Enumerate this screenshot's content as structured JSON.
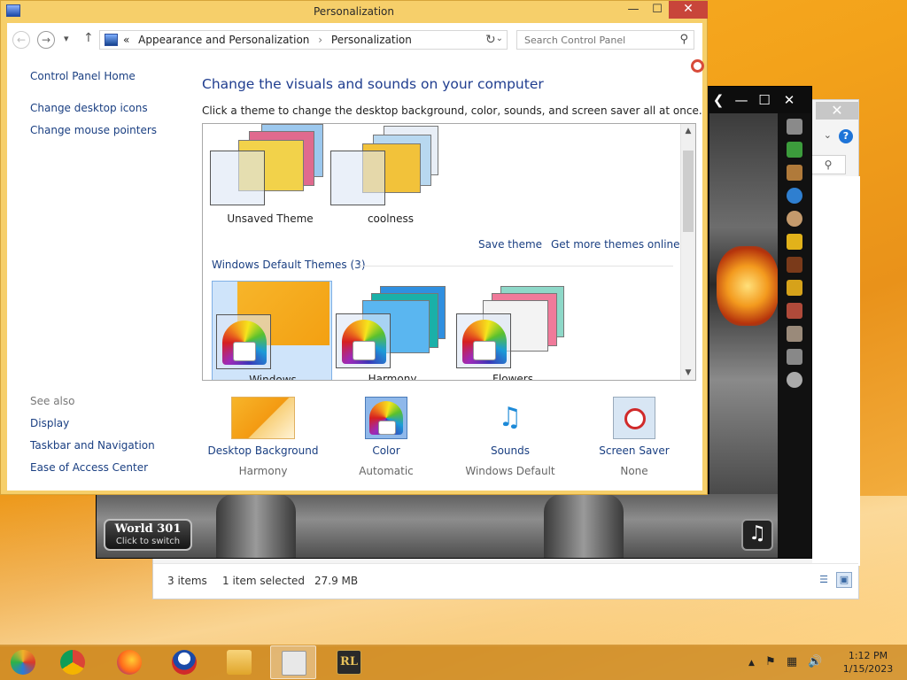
{
  "window": {
    "title": "Personalization",
    "minimize": "—",
    "maximize": "☐",
    "close": "✕"
  },
  "nav": {
    "back": "←",
    "forward": "→",
    "recent": "▾",
    "up": "↑",
    "breadcrumb": [
      "Appearance and Personalization",
      "Personalization"
    ],
    "breadcrumb_prefix": "«",
    "separator": "›",
    "dropdown": "⌄",
    "refresh": "↻",
    "search_placeholder": "Search Control Panel",
    "search_icon": "⚲"
  },
  "left_nav": {
    "home": "Control Panel Home",
    "items": [
      "Change desktop icons",
      "Change mouse pointers"
    ]
  },
  "see_also": {
    "title": "See also",
    "items": [
      "Display",
      "Taskbar and Navigation",
      "Ease of Access Center"
    ]
  },
  "main": {
    "title": "Change the visuals and sounds on your computer",
    "subtitle": "Click a theme to change the desktop background, color, sounds, and screen saver all at once.",
    "my_themes": [
      {
        "name": "Unsaved Theme"
      },
      {
        "name": "coolness"
      }
    ],
    "links": {
      "save": "Save theme",
      "more": "Get more themes online"
    },
    "default_group": "Windows Default Themes (3)",
    "default_themes": [
      {
        "name": "Windows",
        "selected": true
      },
      {
        "name": "Harmony",
        "selected": false
      },
      {
        "name": "Flowers",
        "selected": false
      }
    ],
    "scroll_up": "▲",
    "scroll_down": "▼"
  },
  "bottom": [
    {
      "link": "Desktop Background",
      "value": "Harmony",
      "icon": "desktop-background-icon"
    },
    {
      "link": "Color",
      "value": "Automatic",
      "icon": "color-icon"
    },
    {
      "link": "Sounds",
      "value": "Windows Default",
      "icon": "sounds-icon"
    },
    {
      "link": "Screen Saver",
      "value": "None",
      "icon": "screen-saver-icon"
    }
  ],
  "game_window": {
    "world": "World 301",
    "world_sub": "Click to switch",
    "music": "♫",
    "minimize": "—",
    "maximize": "☐",
    "close": "✕",
    "back": "❮"
  },
  "explorer": {
    "close": "✕",
    "help": "?",
    "chevron": "⌄",
    "search_icon": "⚲",
    "items_count": "3 items",
    "selected": "1 item selected",
    "size": "27.9 MB"
  },
  "taskbar": {
    "apps": [
      "ie-icon",
      "chrome-icon",
      "firefox-icon",
      "obama-icon",
      "file-explorer-icon",
      "control-panel-icon",
      "runelite-icon"
    ],
    "tray_up": "▲",
    "tray_flag": "⚑",
    "tray_network": "▦",
    "tray_volume": "🔊",
    "time": "1:12 PM",
    "date": "1/15/2023"
  },
  "colors": {
    "accent_link": "#1a3f82",
    "title_blue": "#1f3d8f",
    "window_frame": "#f6cf6a",
    "close_red": "#c8453a",
    "desktop_orange": "#f3a21a"
  }
}
